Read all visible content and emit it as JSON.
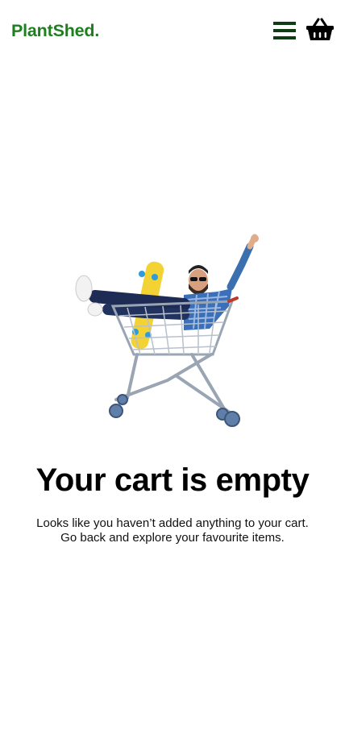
{
  "header": {
    "logo_text": "PlantShed.",
    "menu_icon": "hamburger-menu-icon",
    "cart_icon": "shopping-basket-icon"
  },
  "colors": {
    "brand_green": "#1e7f1e",
    "menu_dark_green": "#0f3d13",
    "text": "#000000",
    "background": "#ffffff"
  },
  "empty_cart": {
    "image_subject": "man-in-shopping-cart-with-skateboard",
    "title": "Your cart is empty",
    "message_line1": "Looks like you haven’t added anything to your cart.",
    "message_line2": "Go back and explore your favourite items."
  }
}
